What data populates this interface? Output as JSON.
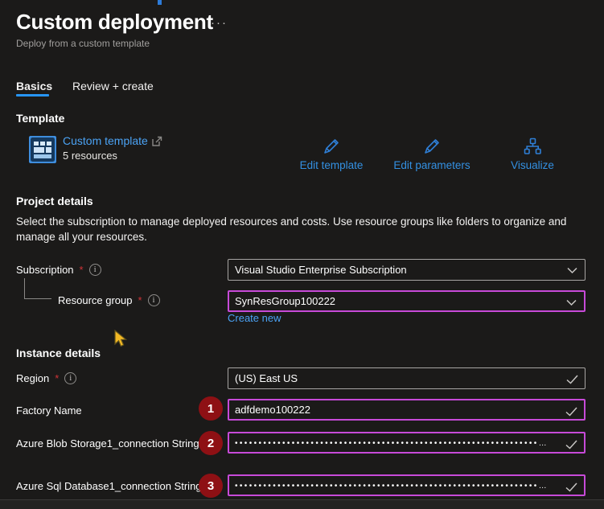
{
  "header": {
    "title": "Custom deployment",
    "more_options": "···",
    "subtitle": "Deploy from a custom template"
  },
  "tabs": [
    {
      "label": "Basics",
      "active": true
    },
    {
      "label": "Review + create",
      "active": false
    }
  ],
  "template": {
    "heading": "Template",
    "link_label": "Custom template",
    "resources_count": "5 resources",
    "actions": [
      {
        "label": "Edit template",
        "icon": "pencil-icon"
      },
      {
        "label": "Edit parameters",
        "icon": "pencil-icon"
      },
      {
        "label": "Visualize",
        "icon": "hierarchy-icon"
      }
    ]
  },
  "project_details": {
    "heading": "Project details",
    "description": "Select the subscription to manage deployed resources and costs. Use resource groups like folders to organize and manage all your resources."
  },
  "form": {
    "subscription": {
      "label": "Subscription",
      "required_mark": "*",
      "value": "Visual Studio Enterprise Subscription"
    },
    "resource_group": {
      "label": "Resource group",
      "required_mark": "*",
      "value": "SynResGroup100222",
      "create_new_label": "Create new"
    }
  },
  "instance_details": {
    "heading": "Instance details",
    "region": {
      "label": "Region",
      "required_mark": "*",
      "value": "(US) East US"
    },
    "factory_name": {
      "label": "Factory Name",
      "value": "adfdemo100222",
      "badge": "1"
    },
    "blob_connection": {
      "label": "Azure Blob Storage1_connection String",
      "masked_value": "••••••••••••••••••••••••••••••••••••••••••••••••••••••••••••••••…",
      "badge": "2"
    },
    "sql_connection": {
      "label": "Azure Sql Database1_connection String",
      "masked_value": "••••••••••••••••••••••••••••••••••••••••••••••••••••••••••••••••…",
      "badge": "3"
    }
  },
  "icons": {
    "info_glyph": "i"
  },
  "colors": {
    "background": "#1b1a19",
    "accent_link_blue": "#4ba3f5",
    "action_link_blue": "#3390e2",
    "tab_underline_blue": "#2795f5",
    "focus_border_purple": "#c74ad8",
    "badge_red": "#8e1014",
    "required_red": "#d13438",
    "muted_text": "#a19f9d"
  }
}
